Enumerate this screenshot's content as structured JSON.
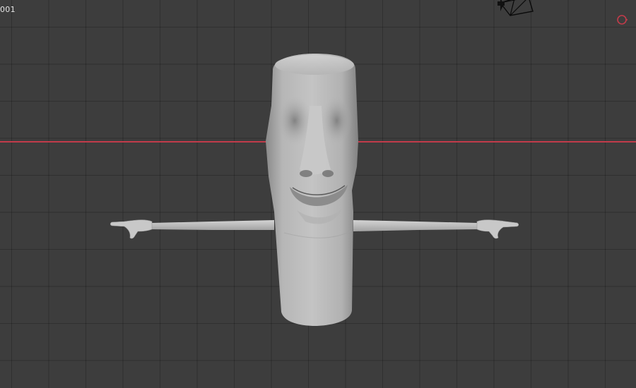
{
  "viewport": {
    "frame_label": "001",
    "axis_color": "#c23b4a",
    "background_color": "#3d3d3d",
    "camera_icon": "camera-gizmo-icon",
    "light_icon": "light-gizmo-icon",
    "object": "moai-character-mesh"
  }
}
